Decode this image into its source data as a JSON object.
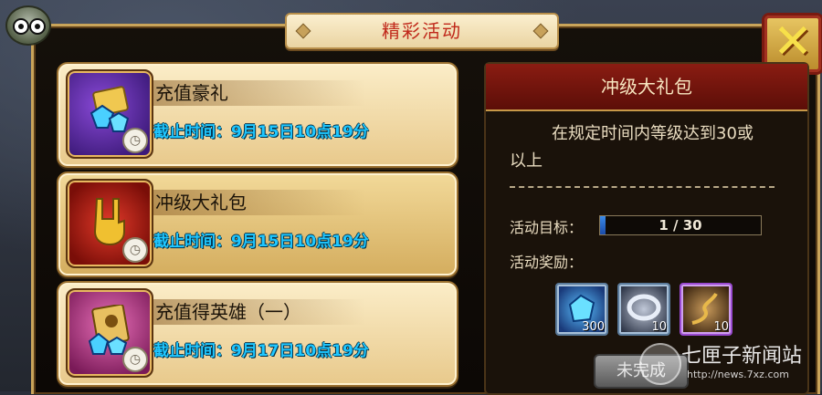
{
  "header": {
    "title": "精彩活动"
  },
  "events": [
    {
      "name": "充值豪礼",
      "deadline": "截止时间：9月15日10点19分",
      "icon": "card-gems-icon"
    },
    {
      "name": "冲级大礼包",
      "deadline": "截止时间：9月15日10点19分",
      "icon": "rock-hand-icon"
    },
    {
      "name": "充值得英雄（一）",
      "deadline": "截止时间：9月17日10点19分",
      "icon": "hero-card-icon"
    }
  ],
  "detail": {
    "title": "冲级大礼包",
    "desc_line1": "在规定时间内等级达到30或",
    "desc_line2": "以上",
    "goal_label": "活动目标：",
    "progress_text": "1 / 30",
    "progress_fraction": 0.033,
    "reward_label": "活动奖励：",
    "rewards": [
      {
        "icon": "blue-gem-icon",
        "count": "300"
      },
      {
        "icon": "silver-ring-icon",
        "count": "10"
      },
      {
        "icon": "golden-whip-icon",
        "count": "10"
      }
    ],
    "status_button": "未完成"
  },
  "watermark": {
    "name": "七匣子新闻站",
    "url": "http://news.7xz.com"
  },
  "colors": {
    "deadline": "#1fc7ff",
    "title_text": "#c0281a",
    "panel_header": "#8a1c12"
  }
}
